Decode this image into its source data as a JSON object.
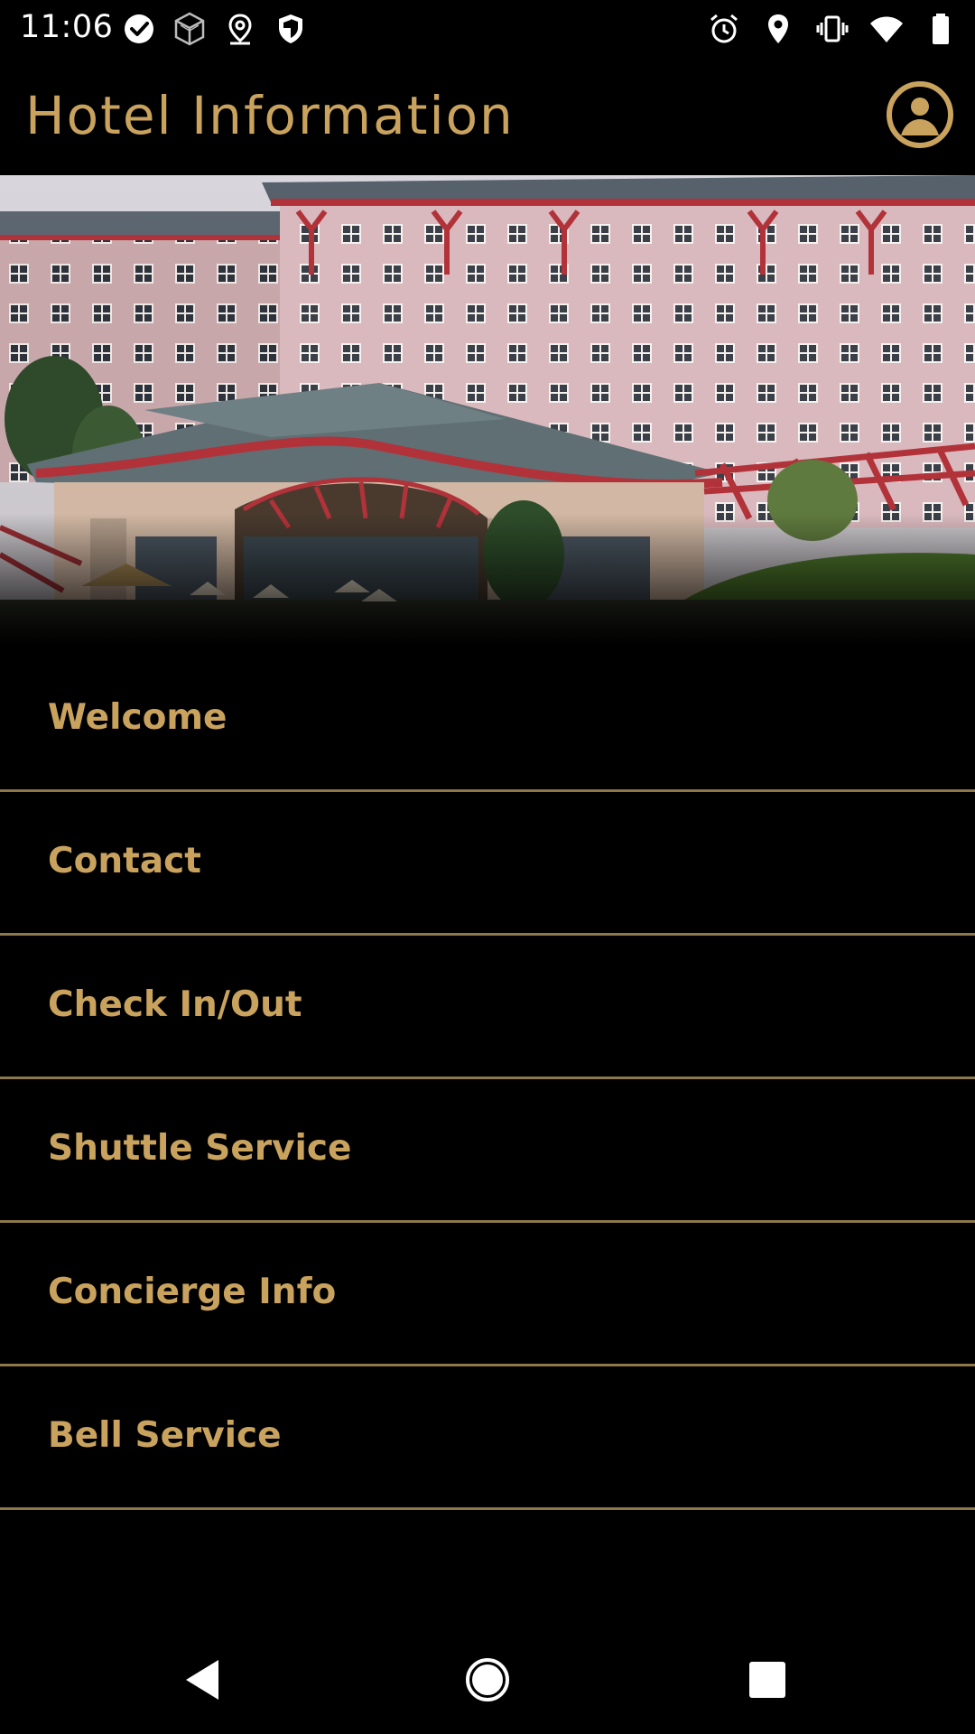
{
  "status_bar": {
    "time": "11:06",
    "left_icons": [
      "check-circle-icon",
      "cube-icon",
      "location-pin-outline-icon",
      "shield-icon"
    ],
    "right_icons": [
      "alarm-icon",
      "location-pin-icon",
      "vibrate-icon",
      "wifi-icon",
      "battery-icon"
    ]
  },
  "header": {
    "title": "Hotel Information",
    "profile_icon": "account-circle-icon"
  },
  "menu": {
    "items": [
      {
        "label": "Welcome"
      },
      {
        "label": "Contact"
      },
      {
        "label": "Check In/Out"
      },
      {
        "label": "Shuttle Service"
      },
      {
        "label": "Concierge Info"
      },
      {
        "label": "Bell Service"
      }
    ]
  },
  "nav_bar": {
    "icons": [
      "back-icon",
      "home-icon",
      "recents-icon"
    ]
  },
  "colors": {
    "accent": "#c9a35e",
    "divider": "#8e774a",
    "background": "#000000"
  }
}
